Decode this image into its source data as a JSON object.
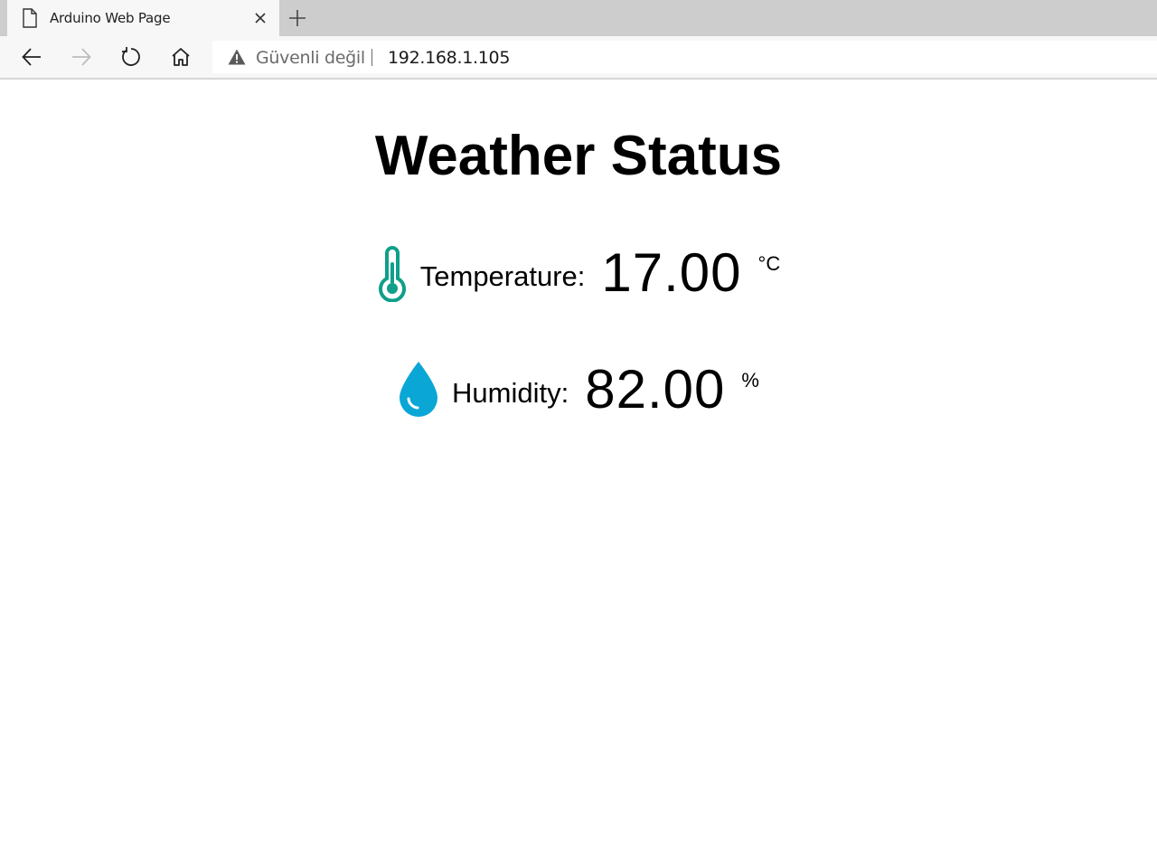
{
  "browser": {
    "tab": {
      "title": "Arduino Web Page"
    },
    "address_bar": {
      "security_label": "Güvenli değil",
      "url": "192.168.1.105"
    },
    "icons": {
      "tab_page": "page-icon",
      "tab_close": "close-icon",
      "new_tab": "plus-icon",
      "back": "back-arrow-icon",
      "forward": "forward-arrow-icon",
      "refresh": "refresh-icon",
      "home": "home-icon",
      "security": "warning-icon"
    }
  },
  "page": {
    "title": "Weather Status",
    "readings": {
      "temperature": {
        "label": "Temperature:",
        "value": "17.00",
        "unit": "°C",
        "icon": "thermometer-icon",
        "color": "#0f9f8a"
      },
      "humidity": {
        "label": "Humidity:",
        "value": "82.00",
        "unit": "%",
        "icon": "water-drop-icon",
        "color": "#0aa6d6"
      }
    }
  }
}
